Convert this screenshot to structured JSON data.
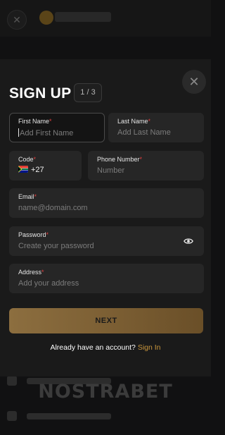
{
  "modal": {
    "title": "SIGN UP",
    "step": "1 / 3"
  },
  "fields": {
    "first_name": {
      "label": "First Name",
      "placeholder": "Add First Name"
    },
    "last_name": {
      "label": "Last Name",
      "placeholder": "Add Last Name"
    },
    "code": {
      "label": "Code",
      "value": "+27",
      "flag": "south-africa-flag"
    },
    "phone": {
      "label": "Phone Number",
      "placeholder": "Number"
    },
    "email": {
      "label": "Email",
      "placeholder": "name@domain.com"
    },
    "password": {
      "label": "Password",
      "placeholder": "Create your password"
    },
    "address": {
      "label": "Address",
      "placeholder": "Add your address"
    }
  },
  "required_marker": "*",
  "actions": {
    "next_label": "NEXT",
    "signin_prompt": "Already have an account?",
    "signin_link": "Sign In"
  },
  "background": {
    "brand": "NOSTRABET"
  },
  "colors": {
    "accent": "#c9963d",
    "button": "#8c6e3f",
    "required": "#e04040",
    "modal_bg": "#1a1a1a",
    "field_bg": "#262626"
  }
}
